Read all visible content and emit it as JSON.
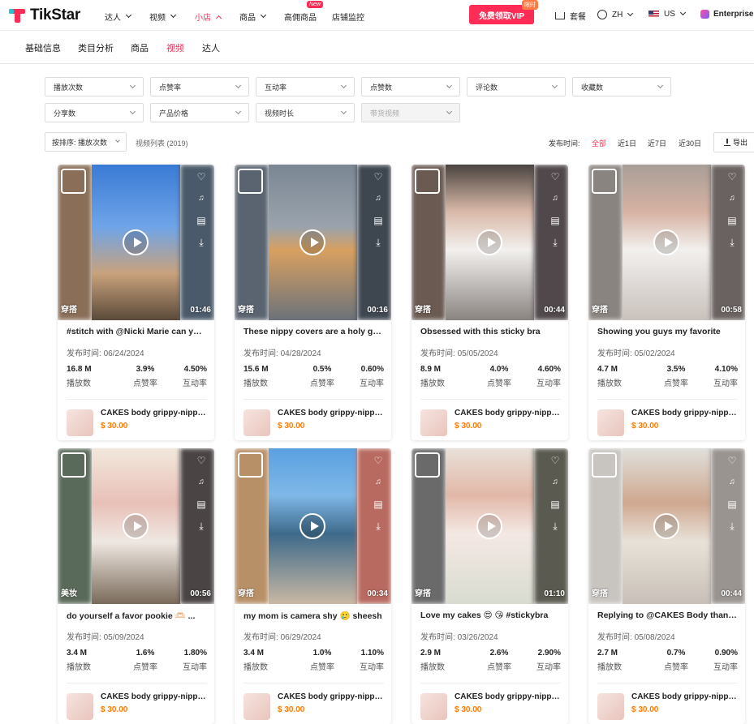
{
  "header": {
    "logo_text": "TikStar",
    "nav": [
      {
        "label": "达人",
        "active": false
      },
      {
        "label": "视频",
        "active": false
      },
      {
        "label": "小店",
        "active": true
      },
      {
        "label": "商品",
        "active": false
      },
      {
        "label": "高佣商品",
        "active": false
      },
      {
        "label": "店铺监控",
        "active": false
      }
    ],
    "new_badge": "New",
    "vip_button": "免费领取VIP",
    "vip_badge": "限时",
    "plan_label": "套餐",
    "language": "ZH",
    "region": "US",
    "enterprise": "Enterprise"
  },
  "subnav": {
    "tabs": [
      {
        "label": "基础信息",
        "active": false
      },
      {
        "label": "类目分析",
        "active": false
      },
      {
        "label": "商品",
        "active": false
      },
      {
        "label": "视频",
        "active": true
      },
      {
        "label": "达人",
        "active": false
      }
    ]
  },
  "filters": {
    "row1": [
      "播放次数",
      "点赞率",
      "互动率",
      "点赞数",
      "评论数",
      "收藏数"
    ],
    "row2": [
      "分享数",
      "产品价格",
      "视频时长",
      "带货视频"
    ]
  },
  "toolbar": {
    "sort_label": "按排序: 播放次数",
    "list_count": "视频列表 (2019)",
    "publish_time_label": "发布时间:",
    "time_options": [
      {
        "label": "全部",
        "active": true
      },
      {
        "label": "近1日",
        "active": false
      },
      {
        "label": "近7日",
        "active": false
      },
      {
        "label": "近30日",
        "active": false
      }
    ],
    "export_label": "导出"
  },
  "labels": {
    "date_prefix": "发布时间:",
    "views": "播放数",
    "like_rate": "点赞率",
    "engagement_rate": "互动率"
  },
  "videos": [
    {
      "title": "#stitch with @Nicki Marie can you help me fin",
      "date": "06/24/2024",
      "views": "16.8 M",
      "like_rate": "3.9%",
      "engagement": "4.50%",
      "category": "穿搭",
      "duration": "01:46",
      "product": "CAKES body grippy-nipple covers",
      "price": "$ 30.00"
    },
    {
      "title": "These nippy covers are a holy grail",
      "date": "04/28/2024",
      "views": "15.6 M",
      "like_rate": "0.5%",
      "engagement": "0.60%",
      "category": "穿搭",
      "duration": "00:16",
      "product": "CAKES body grippy-nipple covers",
      "price": "$ 30.00"
    },
    {
      "title": "Obsessed with this sticky bra",
      "date": "05/05/2024",
      "views": "8.9 M",
      "like_rate": "4.0%",
      "engagement": "4.60%",
      "category": "穿搭",
      "duration": "00:44",
      "product": "CAKES body grippy-nipple covers",
      "price": "$ 30.00"
    },
    {
      "title": "Showing you guys my favorite",
      "date": "05/02/2024",
      "views": "4.7 M",
      "like_rate": "3.5%",
      "engagement": "4.10%",
      "category": "穿搭",
      "duration": "00:58",
      "product": "CAKES body grippy-nipple covers",
      "price": "$ 30.00"
    },
    {
      "title": "do yourself a favor pookie 🫶🏻 ...",
      "date": "05/09/2024",
      "views": "3.4 M",
      "like_rate": "1.6%",
      "engagement": "1.80%",
      "category": "美妆",
      "duration": "00:56",
      "product": "CAKES body grippy-nipple covers",
      "price": "$ 30.00"
    },
    {
      "title": "my mom is camera shy 🥲 sheesh",
      "date": "06/29/2024",
      "views": "3.4 M",
      "like_rate": "1.0%",
      "engagement": "1.10%",
      "category": "穿搭",
      "duration": "00:34",
      "product": "CAKES body grippy-nipple covers",
      "price": "$ 30.00"
    },
    {
      "title": "Love my cakes 😍 😘 #stickybra",
      "date": "03/26/2024",
      "views": "2.9 M",
      "like_rate": "2.6%",
      "engagement": "2.90%",
      "category": "穿搭",
      "duration": "01:10",
      "product": "CAKES body grippy-nipple covers",
      "price": "$ 30.00"
    },
    {
      "title": "Replying to @CAKES Body thank you",
      "date": "05/08/2024",
      "views": "2.7 M",
      "like_rate": "0.7%",
      "engagement": "0.90%",
      "category": "穿搭",
      "duration": "00:44",
      "product": "CAKES body grippy-nipple covers",
      "price": "$ 30.00"
    }
  ],
  "colors": {
    "accent": "#ff2d55",
    "price": "#ff7a00"
  }
}
